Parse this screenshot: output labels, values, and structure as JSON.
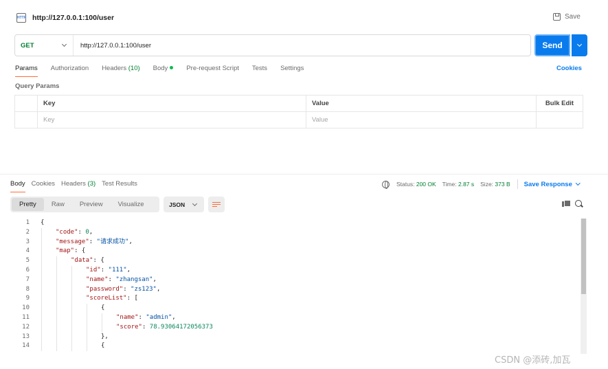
{
  "request": {
    "icon_text": "HTTP",
    "title": "http://127.0.0.1:100/user",
    "save_label": "Save",
    "method": "GET",
    "url": "http://127.0.0.1:100/user",
    "send_label": "Send"
  },
  "request_tabs": [
    {
      "label": "Params",
      "active": true
    },
    {
      "label": "Authorization"
    },
    {
      "label": "Headers",
      "count": "(10)"
    },
    {
      "label": "Body",
      "dot": true
    },
    {
      "label": "Pre-request Script"
    },
    {
      "label": "Tests"
    },
    {
      "label": "Settings"
    }
  ],
  "cookies_link": "Cookies",
  "query_params": {
    "title": "Query Params",
    "headers": {
      "key": "Key",
      "value": "Value",
      "bulk": "Bulk Edit"
    },
    "placeholders": {
      "key": "Key",
      "value": "Value"
    }
  },
  "response": {
    "tabs": [
      {
        "label": "Body",
        "active": true
      },
      {
        "label": "Cookies"
      },
      {
        "label": "Headers",
        "count": "(3)"
      },
      {
        "label": "Test Results"
      }
    ],
    "status_label": "Status:",
    "status_value": "200 OK",
    "time_label": "Time:",
    "time_value": "2.87 s",
    "size_label": "Size:",
    "size_value": "373 B",
    "save_response": "Save Response",
    "view_modes": [
      "Pretty",
      "Raw",
      "Preview",
      "Visualize"
    ],
    "active_view": "Pretty",
    "format": "JSON"
  },
  "code_lines": [
    {
      "n": "1",
      "indent": 0,
      "parts": [
        [
          "p",
          "{"
        ]
      ]
    },
    {
      "n": "2",
      "indent": 1,
      "parts": [
        [
          "k",
          "\"code\""
        ],
        [
          "p",
          ": "
        ],
        [
          "n",
          "0"
        ],
        [
          "p",
          ","
        ]
      ]
    },
    {
      "n": "3",
      "indent": 1,
      "parts": [
        [
          "k",
          "\"message\""
        ],
        [
          "p",
          ": "
        ],
        [
          "s",
          "\"请求成功\""
        ],
        [
          "p",
          ","
        ]
      ]
    },
    {
      "n": "4",
      "indent": 1,
      "parts": [
        [
          "k",
          "\"map\""
        ],
        [
          "p",
          ": {"
        ]
      ]
    },
    {
      "n": "5",
      "indent": 2,
      "parts": [
        [
          "k",
          "\"data\""
        ],
        [
          "p",
          ": {"
        ]
      ]
    },
    {
      "n": "6",
      "indent": 3,
      "parts": [
        [
          "k",
          "\"id\""
        ],
        [
          "p",
          ": "
        ],
        [
          "s",
          "\"111\""
        ],
        [
          "p",
          ","
        ]
      ]
    },
    {
      "n": "7",
      "indent": 3,
      "parts": [
        [
          "k",
          "\"name\""
        ],
        [
          "p",
          ": "
        ],
        [
          "s",
          "\"zhangsan\""
        ],
        [
          "p",
          ","
        ]
      ]
    },
    {
      "n": "8",
      "indent": 3,
      "parts": [
        [
          "k",
          "\"password\""
        ],
        [
          "p",
          ": "
        ],
        [
          "s",
          "\"zs123\""
        ],
        [
          "p",
          ","
        ]
      ]
    },
    {
      "n": "9",
      "indent": 3,
      "parts": [
        [
          "k",
          "\"scoreList\""
        ],
        [
          "p",
          ": ["
        ]
      ]
    },
    {
      "n": "10",
      "indent": 4,
      "parts": [
        [
          "p",
          "{"
        ]
      ]
    },
    {
      "n": "11",
      "indent": 5,
      "parts": [
        [
          "k",
          "\"name\""
        ],
        [
          "p",
          ": "
        ],
        [
          "s",
          "\"admin\""
        ],
        [
          "p",
          ","
        ]
      ]
    },
    {
      "n": "12",
      "indent": 5,
      "parts": [
        [
          "k",
          "\"score\""
        ],
        [
          "p",
          ": "
        ],
        [
          "n",
          "78.93064172056373"
        ]
      ]
    },
    {
      "n": "13",
      "indent": 4,
      "parts": [
        [
          "p",
          "},"
        ]
      ]
    },
    {
      "n": "14",
      "indent": 4,
      "parts": [
        [
          "p",
          "{"
        ]
      ]
    }
  ],
  "watermark": "CSDN @添砖,加瓦",
  "colors": {
    "accent": "#097bed",
    "tab_underline": "#ff6c37",
    "method_get": "#007f31",
    "status_ok": "#007f31",
    "json_key": "#a31515",
    "json_string": "#0451a5",
    "json_number": "#098658"
  }
}
